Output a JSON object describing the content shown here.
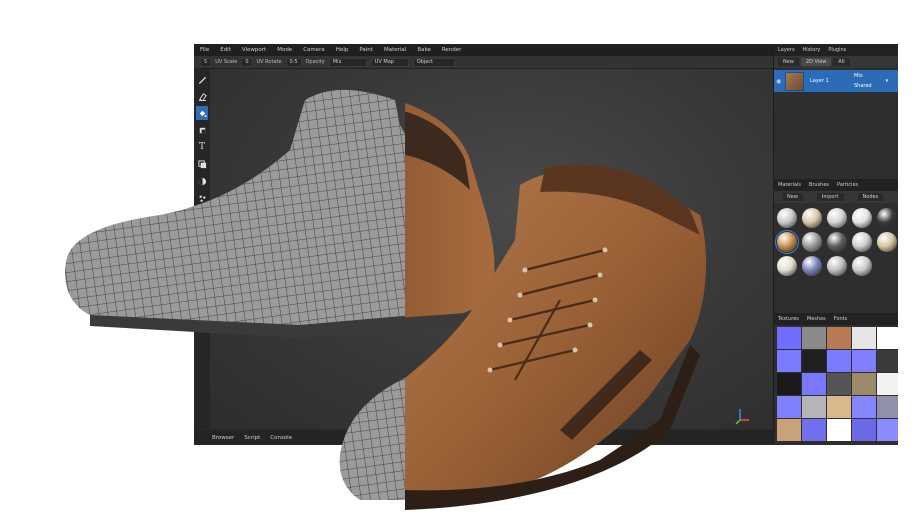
{
  "menubar": {
    "items": [
      "File",
      "Edit",
      "Viewport",
      "Mode",
      "Camera",
      "Help",
      "Paint",
      "Material",
      "Bake",
      "Render"
    ]
  },
  "toolbar": {
    "size_value": "5",
    "uv_scale_label": "UV Scale",
    "uv_scale_value": "0",
    "uv_rotate_label": "UV Rotate",
    "uv_rotate_value": "0.5",
    "opacity_label": "Opacity",
    "opacity_value": "Mix",
    "uv_map_label": "UV Map",
    "object_label": "Object"
  },
  "tools": [
    "brush-icon",
    "eraser-icon",
    "fill-icon",
    "stamp-icon",
    "text-icon",
    "clone-icon",
    "blur-icon",
    "particle-icon",
    "picker-icon"
  ],
  "bottombar": {
    "tabs": [
      "Browser",
      "Script",
      "Console"
    ]
  },
  "panel": {
    "top_tabs": [
      "Layers",
      "History",
      "Plugins"
    ],
    "layer_buttons": [
      "New",
      "2D View",
      "All"
    ],
    "layer": {
      "name": "Layer 1",
      "blend": "Mix",
      "mode": "Shared",
      "arrow": "▾"
    },
    "mat_tabs": [
      "Materials",
      "Brushes",
      "Particles"
    ],
    "mat_buttons": [
      "New",
      "Import",
      "Nodes"
    ],
    "tex_tabs": [
      "Textures",
      "Meshes",
      "Fonts"
    ]
  },
  "colors": {
    "accent": "#2c6bb8",
    "panel": "#2e2e2e",
    "viewport": "#3c3c3c"
  },
  "materials": [
    "#c9c9c9",
    "#d9c7a8",
    "#d4d4d4",
    "#e3e3e3",
    "#3a3a3a",
    "#c9914e",
    "#9a9a9a",
    "#5d5d5d",
    "#cfcfcf",
    "#d5c3a0",
    "#e2ddd0",
    "#7a82b8",
    "#bfbfbf",
    "#cacaca"
  ],
  "textures": [
    "#6f6fff",
    "#8a8a8a",
    "#b77a55",
    "#e5e5e5",
    "#ffffff",
    "#7a7aff",
    "#202020",
    "#7b7bff",
    "#8080ff",
    "#3a3a3a",
    "#1a1a1a",
    "#7878ff",
    "#555555",
    "#9a8a6a",
    "#f2f2f2",
    "#8080ff",
    "#b5b5b5",
    "#d9b98c",
    "#8585ff",
    "#9090a8",
    "#caa27a",
    "#7070ee",
    "#ffffff",
    "#6a6ae6",
    "#8a8aff"
  ]
}
